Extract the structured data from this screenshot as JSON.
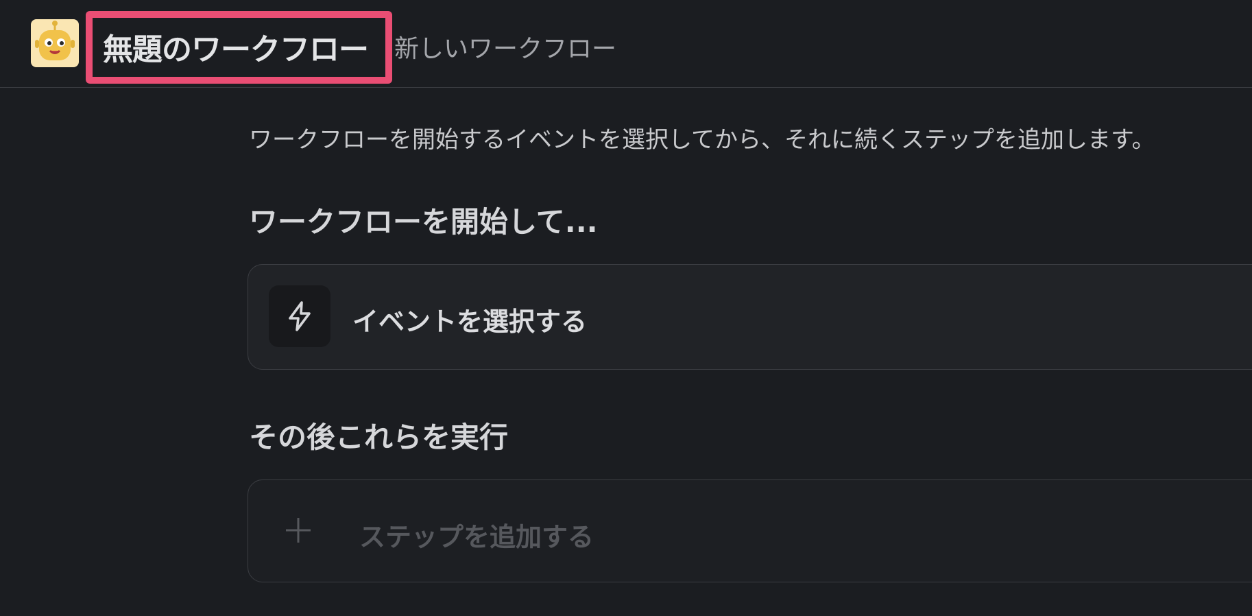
{
  "header": {
    "avatar_icon": "robot-mascot-icon",
    "title": "無題のワークフロー",
    "subtitle": "新しいワークフロー",
    "highlight_color": "#ea4e74"
  },
  "main": {
    "description": "ワークフローを開始するイベントを選択してから、それに続くステップを追加します。",
    "start_heading": "ワークフローを開始して...",
    "event_card": {
      "icon": "lightning-bolt-icon",
      "label": "イベントを選択する"
    },
    "then_heading": "その後これらを実行",
    "step_card": {
      "icon": "plus-icon",
      "label": "ステップを追加する"
    }
  }
}
